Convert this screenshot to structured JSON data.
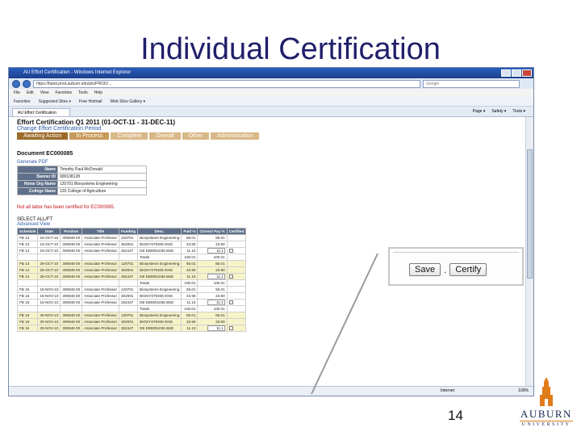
{
  "slide": {
    "title": "Individual Certification",
    "page_number": "14"
  },
  "browser": {
    "window_title": "AU Effort Certification - Windows Internet Explorer",
    "url": "https://banit.prod.auburn.edu/pls/PROD/…",
    "search_placeholder": "Google",
    "menu": [
      "File",
      "Edit",
      "View",
      "Favorites",
      "Tools",
      "Help"
    ],
    "favorites": [
      "Favorites",
      "Suggested Sites ▾",
      "Free Hotmail",
      "Web Slice Gallery ▾"
    ],
    "tab_label": "AU Effort Certification",
    "tools": [
      "Page ▾",
      "Safety ▾",
      "Tools ▾"
    ],
    "status": {
      "zone": "Internet",
      "zoom": "100%"
    }
  },
  "app": {
    "heading": "Effort Certification Q1 2011 (01-OCT-11 - 31-DEC-11)",
    "change_period": "Change Effort Certification Period",
    "tabs": [
      "Awaiting Action",
      "In Process",
      "Complete",
      "Overall",
      "Other",
      "Administration"
    ],
    "document": "Document EC000085",
    "generate_pdf": "Generate PDF",
    "info": [
      {
        "k": "Name",
        "v": "Timothy Paul McDonald"
      },
      {
        "k": "Banner ID",
        "v": "900108128"
      },
      {
        "k": "Home Org Name",
        "v": "120701 Biosystems Engineering"
      },
      {
        "k": "College Name",
        "v": "120 College of Agriculture"
      }
    ],
    "error": "Not all labor has been certified for EC000085.",
    "select_all": "SELECT ALL/FT",
    "advanced_view": "Advanced View",
    "columns": [
      "Schedule",
      "Date",
      "Position",
      "Title",
      "Funding",
      "Desc.",
      "Paid %",
      "Correct Pay %",
      "Certified"
    ],
    "rows": [
      {
        "type": "w",
        "c": [
          "FB 13",
          "15-OCT-10",
          "300848 00",
          "Associate Professor",
          "120701",
          "Biosystems Engineering",
          "65.01",
          "65.01"
        ],
        "input": false
      },
      {
        "type": "w",
        "c": [
          "FB 13",
          "15-OCT-10",
          "300848 00",
          "Associate Professor",
          "302001",
          "BIOSYSTEMS ENG",
          "23.90",
          "23.90"
        ],
        "input": false
      },
      {
        "type": "w",
        "c": [
          "FB 13",
          "15-OCT-10",
          "300848 00",
          "Associate Professor",
          "262447",
          "DE EB0001036 BSE",
          "11.10",
          "11.1"
        ],
        "input": true
      },
      {
        "type": "t",
        "c": [
          "",
          "",
          "",
          "",
          "",
          "Totals",
          "100.01",
          "100.01"
        ],
        "input": false
      },
      {
        "type": "y",
        "c": [
          "FB 14",
          "29-OCT-10",
          "300848 00",
          "Associate Professor",
          "120701",
          "Biosystems Engineering",
          "65.01",
          "65.01"
        ],
        "input": false
      },
      {
        "type": "y",
        "c": [
          "FB 14",
          "29-OCT-10",
          "300848 00",
          "Associate Professor",
          "302001",
          "BIOSYSTEMS ENG",
          "23.90",
          "23.90"
        ],
        "input": false
      },
      {
        "type": "y",
        "c": [
          "FB 14",
          "29-OCT-10",
          "300848 00",
          "Associate Professor",
          "262447",
          "DE EB0001036 BSE",
          "11.10",
          "11.1"
        ],
        "input": true
      },
      {
        "type": "t",
        "c": [
          "",
          "",
          "",
          "",
          "",
          "Totals",
          "100.01",
          "100.01"
        ],
        "input": false
      },
      {
        "type": "w",
        "c": [
          "FB 15",
          "15-NOV-10",
          "300848 00",
          "Associate Professor",
          "120701",
          "Biosystems Engineering",
          "65.01",
          "65.01"
        ],
        "input": false
      },
      {
        "type": "w",
        "c": [
          "FB 15",
          "15-NOV-10",
          "300848 00",
          "Associate Professor",
          "302001",
          "BIOSYSTEMS ENG",
          "23.90",
          "23.90"
        ],
        "input": false
      },
      {
        "type": "w",
        "c": [
          "FB 15",
          "15-NOV-10",
          "300848 00",
          "Associate Professor",
          "262447",
          "DE EB0001036 BSE",
          "11.10",
          "11.1"
        ],
        "input": true
      },
      {
        "type": "t",
        "c": [
          "",
          "",
          "",
          "",
          "",
          "Totals",
          "100.01",
          "100.01"
        ],
        "input": false
      },
      {
        "type": "y",
        "c": [
          "FB 16",
          "30-NOV-10",
          "300848 00",
          "Associate Professor",
          "120701",
          "Biosystems Engineering",
          "65.01",
          "65.01"
        ],
        "input": false
      },
      {
        "type": "y",
        "c": [
          "FB 16",
          "30-NOV-10",
          "300848 00",
          "Associate Professor",
          "302001",
          "BIOSYSTEMS ENG",
          "23.90",
          "23.90"
        ],
        "input": false
      },
      {
        "type": "y",
        "c": [
          "FB 16",
          "30-NOV-10",
          "300848 00",
          "Associate Professor",
          "262447",
          "DE EB0001036 BSE",
          "11.10",
          "11.1"
        ],
        "input": true
      }
    ]
  },
  "callout": {
    "save": "Save",
    "separator": ".",
    "certify": "Certify"
  },
  "logo": {
    "name": "AUBURN",
    "sub": "UNIVERSITY"
  },
  "colors": {
    "title": "#1f1f6a",
    "tab": "#c89a5a",
    "header": "#5d6f8a",
    "error": "#c0151b",
    "link": "#2a5aa8"
  }
}
